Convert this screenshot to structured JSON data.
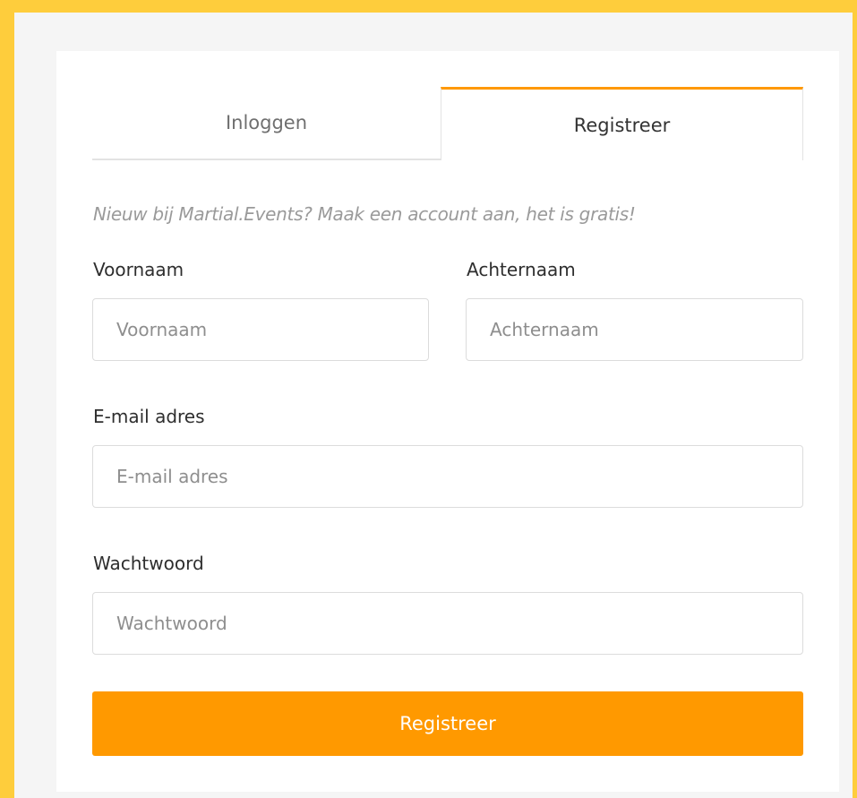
{
  "colors": {
    "page_background": "#fecd3c",
    "panel_background": "#f5f5f5",
    "accent": "#ff9900",
    "intro_text": "#9a9a9a"
  },
  "tabs": {
    "login_label": "Inloggen",
    "register_label": "Registreer",
    "active": "register"
  },
  "intro_text": "Nieuw bij Martial.Events? Maak een account aan, het is gratis!",
  "form": {
    "first_name": {
      "label": "Voornaam",
      "placeholder": "Voornaam",
      "value": ""
    },
    "last_name": {
      "label": "Achternaam",
      "placeholder": "Achternaam",
      "value": ""
    },
    "email": {
      "label": "E-mail adres",
      "placeholder": "E-mail adres",
      "value": ""
    },
    "password": {
      "label": "Wachtwoord",
      "placeholder": "Wachtwoord",
      "value": ""
    },
    "submit_label": "Registreer"
  }
}
